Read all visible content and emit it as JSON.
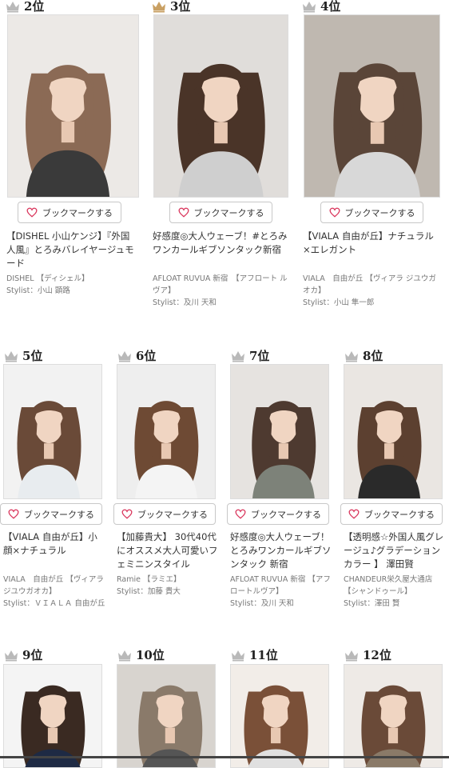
{
  "bookmark_label": "ブックマークする",
  "colors": {
    "gold": "#c9a063",
    "silver": "#b9b9b9",
    "heart": "#d9345b"
  },
  "items": [
    {
      "rank": "2位",
      "crown": "silver",
      "title": "【DISHEL 小山ケンジ】『外国人風』とろみバレイヤージュモード",
      "salon": "DISHEL 【ディシェル】",
      "stylist": "Stylist：小山 顕路",
      "bg": "#ece9e6",
      "hair": "#8b6a55",
      "top": "#3a3a3a"
    },
    {
      "rank": "3位",
      "crown": "gold",
      "title": "好感度◎大人ウェーブ！#とろみワンカールギブソンタック新宿",
      "salon": "AFLOAT RUVUA 新宿　【アフロート ルヴア】",
      "stylist": "Stylist：及川 天和",
      "bg": "#e0ddda",
      "hair": "#4a3428",
      "top": "#cfcfcf"
    },
    {
      "rank": "4位",
      "crown": "silver",
      "title": "【VIALA 自由が丘】ナチュラル×エレガント",
      "salon": "VIALA　自由が丘 【ヴィアラ ジユウガオカ】",
      "stylist": "Stylist：小山 隼一郎",
      "bg": "#bfb8b0",
      "hair": "#5a4538",
      "top": "#d8d8d8"
    },
    {
      "rank": "5位",
      "crown": "silver",
      "title": "【VIALA 自由が丘】小顔×ナチュラル",
      "salon": "VIALA　自由が丘 【ヴィアラ ジユウガオカ】",
      "stylist": "Stylist：ＶＩＡＬＡ 自由が丘",
      "bg": "#f2f2f2",
      "hair": "#6a4a38",
      "top": "#e8ecef"
    },
    {
      "rank": "6位",
      "crown": "silver",
      "title": "【加藤貴大】 30代40代にオススメ大人可愛いフェミニンスタイル",
      "salon": "Ramie 【ラミエ】",
      "stylist": "Stylist：加藤 貴大",
      "bg": "#eeeeee",
      "hair": "#6e4a34",
      "top": "#f4f4f4"
    },
    {
      "rank": "7位",
      "crown": "silver",
      "title": "好感度◎大人ウェーブ！とろみワンカールギブソンタック 新宿",
      "salon": "AFLOAT RUVUA 新宿 【アフロートルヴア】",
      "stylist": "Stylist：及川 天和",
      "bg": "#e6e3e0",
      "hair": "#4e3a30",
      "top": "#7d8279"
    },
    {
      "rank": "8位",
      "crown": "silver",
      "title": "【透明感☆外国人風グレージュ♪グラデーションカラー 】 澤田賢",
      "salon": "CHANDEUR栄久屋大通店 【シャンドゥール】",
      "stylist": "Stylist：澤田 賢",
      "bg": "#eae6e2",
      "hair": "#5c4030",
      "top": "#2a2a2a"
    },
    {
      "rank": "9位",
      "crown": "silver",
      "title": "",
      "salon": "",
      "stylist": "",
      "bg": "#f4f4f4",
      "hair": "#3a2a22",
      "top": "#1e2a44"
    },
    {
      "rank": "10位",
      "crown": "silver",
      "title": "",
      "salon": "",
      "stylist": "",
      "bg": "#d8d4cf",
      "hair": "#8a7a6a",
      "top": "#555555"
    },
    {
      "rank": "11位",
      "crown": "silver",
      "title": "",
      "salon": "",
      "stylist": "",
      "bg": "#f2ede8",
      "hair": "#7a5038",
      "top": "#e0e0e0"
    },
    {
      "rank": "12位",
      "crown": "silver",
      "title": "",
      "salon": "",
      "stylist": "",
      "bg": "#eeeae6",
      "hair": "#6a4a38",
      "top": "#8a7a68"
    }
  ]
}
